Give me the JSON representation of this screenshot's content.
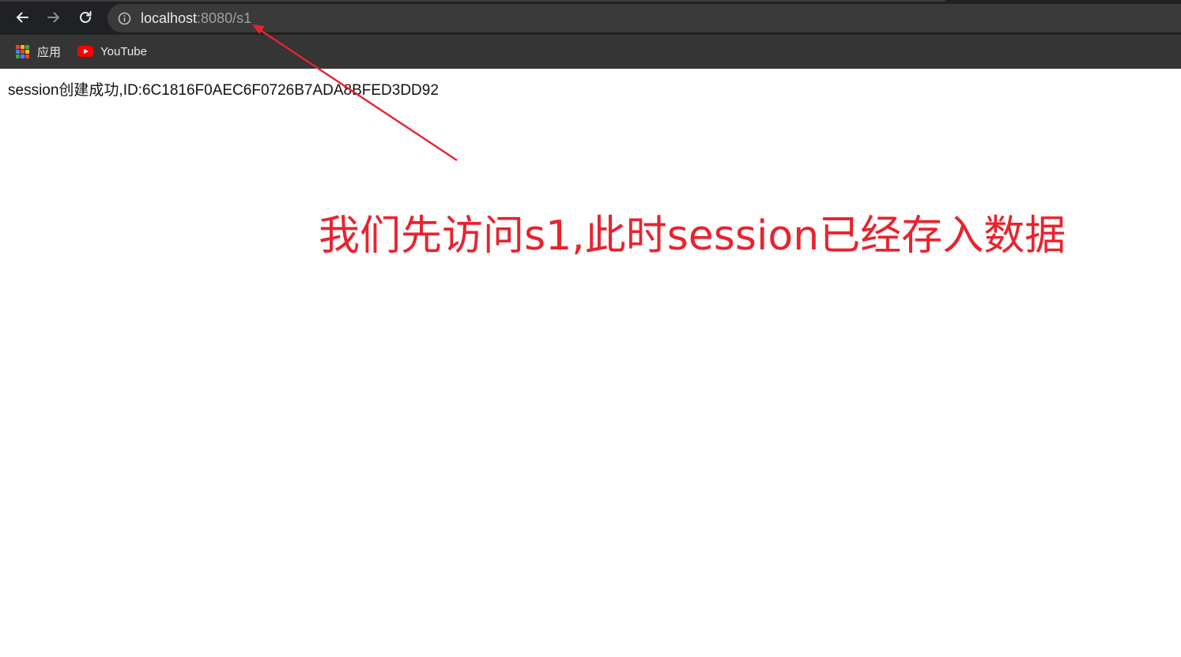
{
  "browser": {
    "url_host": "localhost",
    "url_path": ":8080/s1",
    "icons": {
      "back": "back-arrow-icon",
      "forward": "forward-arrow-icon",
      "reload": "reload-icon",
      "site_info": "info-icon"
    }
  },
  "bookmarks": [
    {
      "label": "应用",
      "icon": "apps-grid-icon"
    },
    {
      "label": "YouTube",
      "icon": "youtube-icon"
    }
  ],
  "page": {
    "message": "session创建成功,ID:6C1816F0AEC6F0726B7ADA8BFED3DD92"
  },
  "annotation": {
    "text": "我们先访问s1,此时session已经存入数据",
    "color": "#e8232e"
  },
  "colors": {
    "toolbar_bg": "#202124",
    "bookmarks_bg": "#353535",
    "omnibox_bg": "#3a3a3a"
  }
}
